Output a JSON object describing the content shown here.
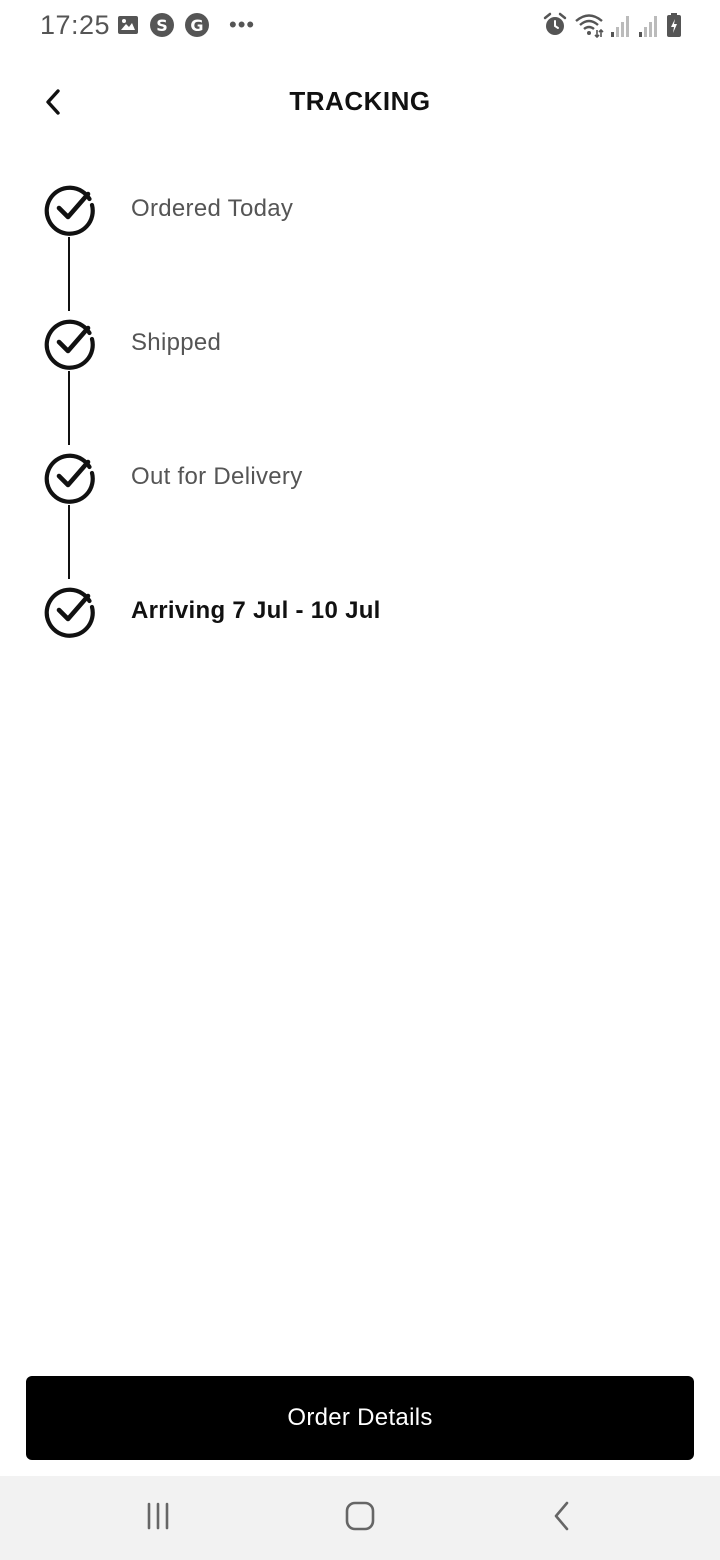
{
  "status_bar": {
    "time": "17:25",
    "more_indicator": "•••",
    "left_icons": [
      "image-icon",
      "skype-icon",
      "google-icon"
    ],
    "right_icons": [
      "alarm-icon",
      "wifi-icon",
      "signal-icon",
      "signal-icon",
      "battery-charging-icon"
    ]
  },
  "header": {
    "title": "TRACKING",
    "back_icon": "chevron-left-icon"
  },
  "timeline": {
    "steps": [
      {
        "label": "Ordered Today",
        "completed": true,
        "emphasis": false
      },
      {
        "label": "Shipped",
        "completed": true,
        "emphasis": false
      },
      {
        "label": "Out for Delivery",
        "completed": true,
        "emphasis": false
      },
      {
        "label": "Arriving 7 Jul - 10 Jul",
        "completed": true,
        "emphasis": true
      }
    ]
  },
  "footer": {
    "order_details_label": "Order Details"
  },
  "nav_bar": {
    "buttons": [
      "recent-apps-icon",
      "home-icon",
      "back-icon"
    ]
  },
  "colors": {
    "primary": "#000000",
    "text_muted": "#555555",
    "nav_background": "#f2f2f2"
  }
}
